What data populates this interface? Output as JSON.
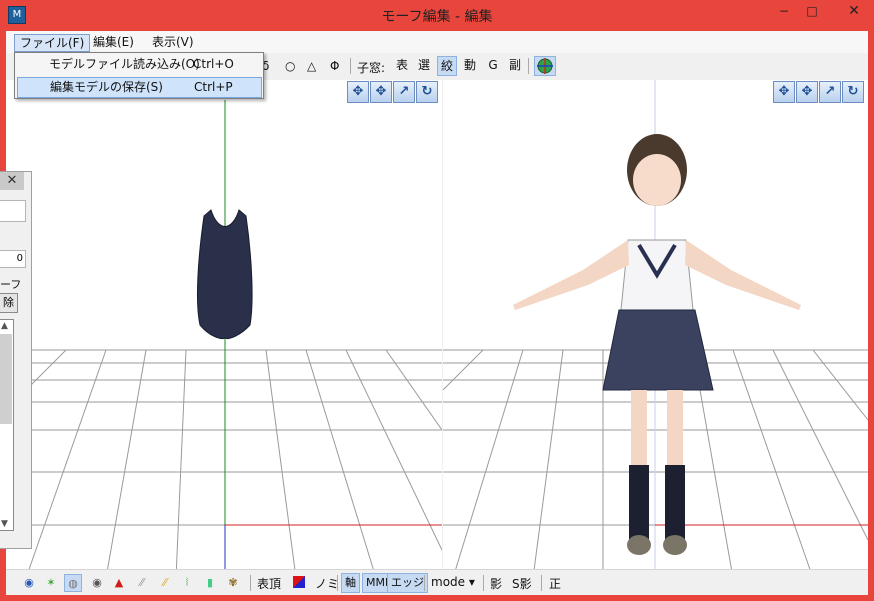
{
  "window": {
    "title": "モーフ編集 - 編集",
    "app_icon": "app-icon",
    "minimize": "−",
    "maximize": "□",
    "close": "✕"
  },
  "menubar": {
    "file": "ファイル(F)",
    "edit": "編集(E)",
    "view": "表示(V)"
  },
  "file_menu": {
    "items": [
      {
        "label": "モデルファイル読み込み(O)",
        "shortcut": "Ctrl+O"
      },
      {
        "label": "編集モデルの保存(S)",
        "shortcut": "Ctrl+P"
      }
    ]
  },
  "toolbar_top": {
    "shape_circle_small": "δ",
    "shape_circle": "○",
    "shape_triangle": "△",
    "shape_phi": "Φ",
    "child_window_label": "子窓:",
    "btn_hyo": "表",
    "btn_sen": "選",
    "btn_shibo": "絞",
    "btn_do": "動",
    "btn_g": "G",
    "btn_fuku": "副",
    "target_icon": "crosshair-icon"
  },
  "viewport_tools": [
    "move-xy-icon",
    "move-xz-icon",
    "rotate-axis-icon",
    "rotate-icon"
  ],
  "side_panel": {
    "close": "✕",
    "value": "0",
    "label": "ーフ",
    "button": "除",
    "up": "▲",
    "down": "▼"
  },
  "toolbar_bottom": {
    "vertex_label": "表頂",
    "nomi_label": "ノミ",
    "axis_label": "軸",
    "mmd_label": "MMD",
    "edge_label": "エッジ",
    "mode_label": "mode ▾",
    "shadow_label": "影",
    "sshadow_label": "S影",
    "front_label": "正"
  },
  "colors": {
    "accent": "#e8453c",
    "selection": "#cfe3fa",
    "active_button": "#c6daf3"
  }
}
